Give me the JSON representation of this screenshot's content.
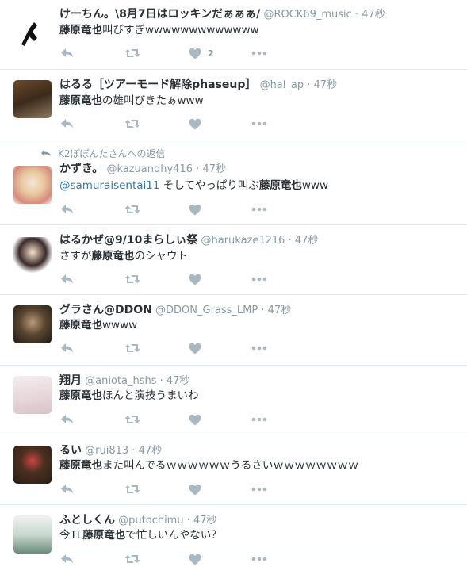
{
  "tweets": [
    {
      "fullname": "けーちん。\\8月7日はロッキンだぁぁぁ/",
      "username": "@ROCK69_music",
      "sep": "·",
      "time": "47秒",
      "text_parts": [
        {
          "t": "藤原竜也",
          "kw": true
        },
        {
          "t": "叫びすぎwwwwwwwwwwwww"
        }
      ],
      "likes": "2"
    },
    {
      "fullname": "はるる［ツアーモード解除phaseup］",
      "username": "@hal_ap",
      "sep": "·",
      "time": "47秒",
      "text_parts": [
        {
          "t": "藤原竜也",
          "kw": true
        },
        {
          "t": "の雄叫びきたぁwww"
        }
      ],
      "likes": ""
    },
    {
      "context": "K2ぽぽんたさんへの返信",
      "fullname": "かずき。",
      "username": "@kazuandhy416",
      "sep": "·",
      "time": "47秒",
      "text_parts": [
        {
          "t": "@samuraisentai11",
          "mention": true
        },
        {
          "t": " そしてやっぱり叫ぶ"
        },
        {
          "t": "藤原竜也",
          "kw": true
        },
        {
          "t": "www"
        }
      ],
      "likes": ""
    },
    {
      "fullname": "はるかぜ@9/10まらしぃ祭",
      "username": "@harukaze1216",
      "sep": "·",
      "time": "47秒",
      "text_parts": [
        {
          "t": "さすが"
        },
        {
          "t": "藤原竜也",
          "kw": true
        },
        {
          "t": "のシャウト"
        }
      ],
      "likes": ""
    },
    {
      "fullname": "グラさん@DDON",
      "username": "@DDON_Grass_LMP",
      "sep": "·",
      "time": "47秒",
      "text_parts": [
        {
          "t": "藤原竜也",
          "kw": true
        },
        {
          "t": "wwww"
        }
      ],
      "likes": ""
    },
    {
      "fullname": "翔月",
      "username": "@aniota_hshs",
      "sep": "·",
      "time": "47秒",
      "text_parts": [
        {
          "t": "藤原竜也",
          "kw": true
        },
        {
          "t": "ほんと演技うまいわ"
        }
      ],
      "likes": ""
    },
    {
      "fullname": "るい",
      "username": "@rui813",
      "sep": "·",
      "time": "47秒",
      "text_parts": [
        {
          "t": "藤原竜也",
          "kw": true
        },
        {
          "t": "また叫んでるｗｗｗｗｗｗうるさいｗｗｗｗｗｗｗｗ"
        }
      ],
      "likes": ""
    },
    {
      "fullname": "ふとしくん",
      "username": "@putochimu",
      "sep": "·",
      "time": "47秒",
      "text_parts": [
        {
          "t": "今TL"
        },
        {
          "t": "藤原竜也",
          "kw": true
        },
        {
          "t": "で忙しいんやない？"
        }
      ],
      "likes": ""
    }
  ],
  "icons": {
    "reply": "reply-icon",
    "retweet": "retweet-icon",
    "like": "heart-icon",
    "more": "more-icon"
  },
  "colors": {
    "icon": "#aab8c2",
    "muted": "#8899a6",
    "link": "#2b7bb9",
    "border": "#e1e8ed"
  }
}
